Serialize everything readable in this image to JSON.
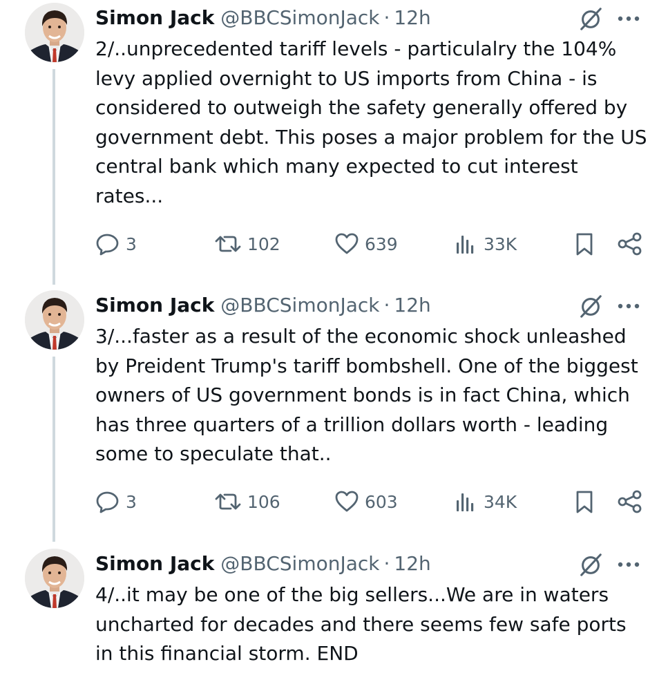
{
  "tweets": [
    {
      "author_name": "Simon Jack",
      "handle": "@BBCSimonJack",
      "separator": "·",
      "time": "12h",
      "text": "2/..unprecedented tariff levels - particulalry the 104% levy applied overnight to US imports from China - is considered to outweigh the safety generally offered by government debt. This poses a major problem for the US central bank which many expected to cut interest rates...",
      "replies": "3",
      "reposts": "102",
      "likes": "639",
      "views": "33K"
    },
    {
      "author_name": "Simon Jack",
      "handle": "@BBCSimonJack",
      "separator": "·",
      "time": "12h",
      "text": "3/...faster as a result of the economic shock unleashed by Preident Trump's tariff bombshell. One of the biggest owners of US government bonds is in fact China, which has three quarters of a trillion dollars worth -  leading some to speculate that..",
      "replies": "3",
      "reposts": "106",
      "likes": "603",
      "views": "34K"
    },
    {
      "author_name": "Simon Jack",
      "handle": "@BBCSimonJack",
      "separator": "·",
      "time": "12h",
      "text": "4/..it may be one of the big sellers...We are in waters uncharted for decades and there seems few safe ports in this financial storm. END"
    }
  ],
  "colors": {
    "text": "#0f1419",
    "secondary": "#536471",
    "thread_line": "#cfd9de"
  },
  "icons": [
    "grok-icon",
    "more-icon",
    "reply-icon",
    "repost-icon",
    "like-icon",
    "views-icon",
    "bookmark-icon",
    "share-icon"
  ]
}
